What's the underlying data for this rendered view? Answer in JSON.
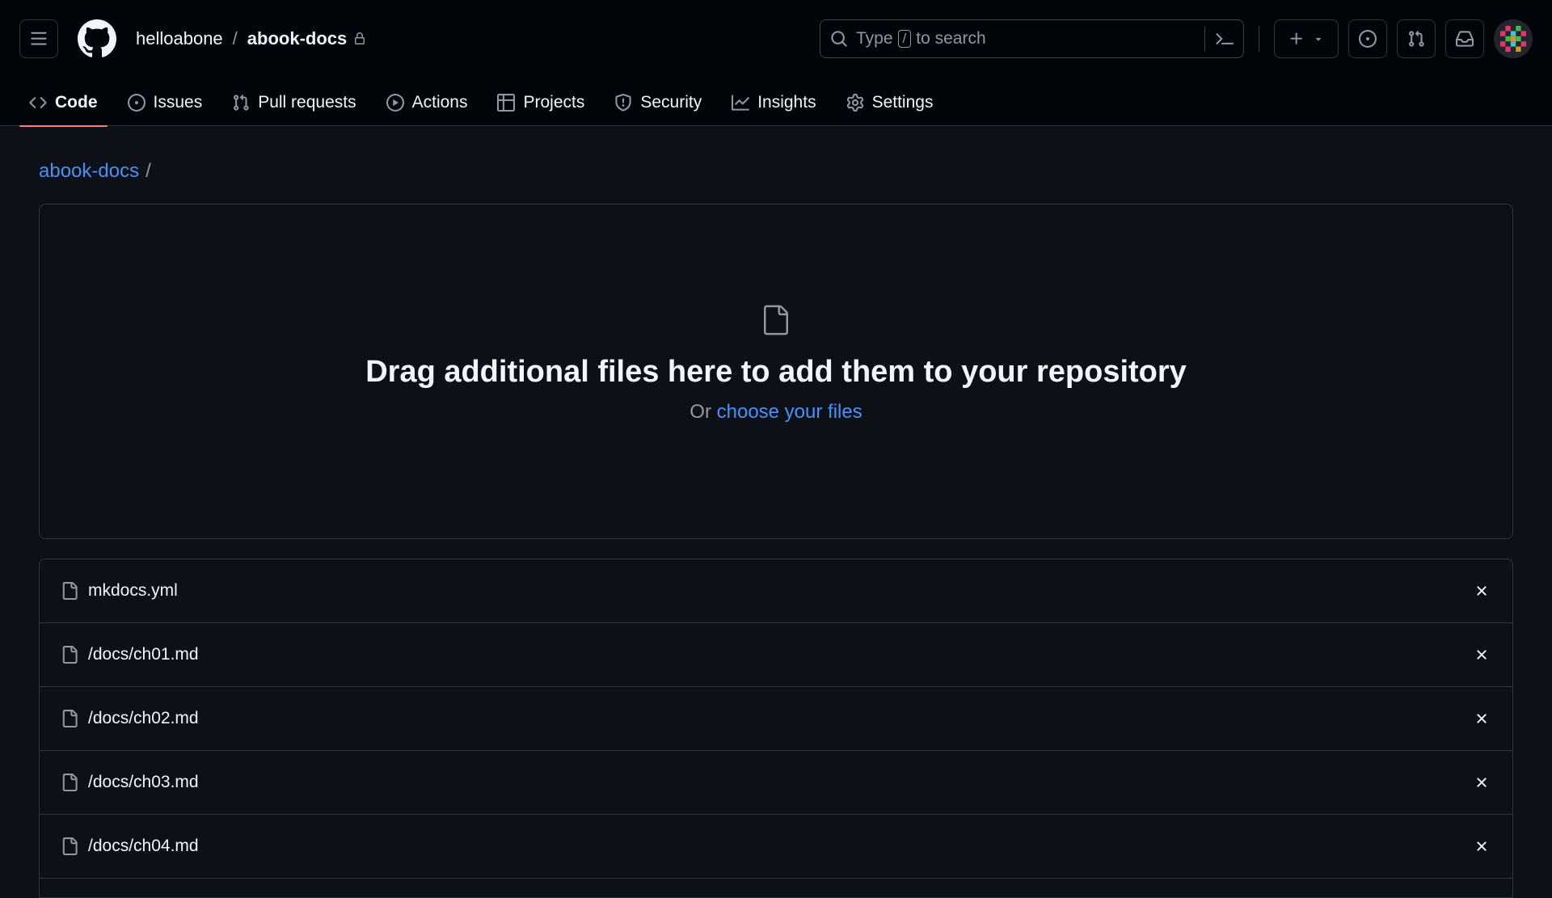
{
  "header": {
    "owner": "helloabone",
    "separator": "/",
    "repo": "abook-docs",
    "search": {
      "prefix": "Type",
      "key": "/",
      "suffix": "to search"
    }
  },
  "tabs": [
    {
      "label": "Code",
      "icon": "code-icon",
      "selected": true
    },
    {
      "label": "Issues",
      "icon": "issue-opened-icon"
    },
    {
      "label": "Pull requests",
      "icon": "git-pull-request-icon"
    },
    {
      "label": "Actions",
      "icon": "play-icon"
    },
    {
      "label": "Projects",
      "icon": "table-icon"
    },
    {
      "label": "Security",
      "icon": "shield-icon"
    },
    {
      "label": "Insights",
      "icon": "graph-icon"
    },
    {
      "label": "Settings",
      "icon": "gear-icon"
    }
  ],
  "breadcrumb": {
    "repo": "abook-docs",
    "slash": "/"
  },
  "dropzone": {
    "title": "Drag additional files here to add them to your repository",
    "or_text": "Or",
    "choose_link": "choose your files"
  },
  "files": [
    {
      "name": "mkdocs.yml"
    },
    {
      "name": "/docs/ch01.md"
    },
    {
      "name": "/docs/ch02.md"
    },
    {
      "name": "/docs/ch03.md"
    },
    {
      "name": "/docs/ch04.md"
    }
  ],
  "colors": {
    "background": "#0d1117",
    "header": "#010409",
    "link": "#4493f8",
    "tab_underline": "#f78166",
    "border": "#30363d"
  }
}
